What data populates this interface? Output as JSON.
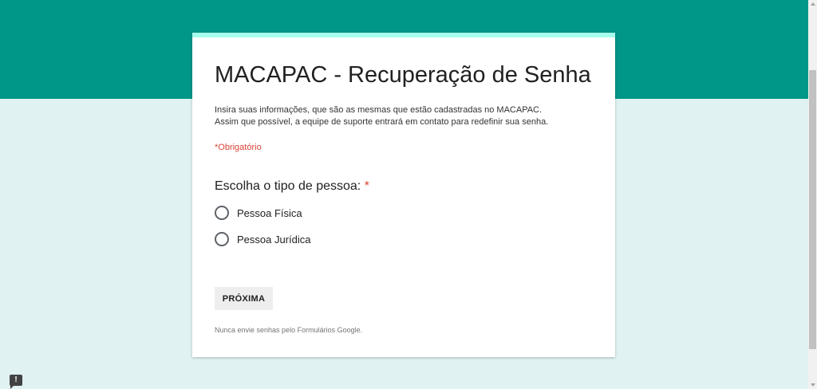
{
  "form": {
    "title": "MACAPAC - Recuperação de Senha",
    "description_line1": "Insira suas informações, que são as mesmas que estão cadastradas no MACAPAC.",
    "description_line2": "Assim que possível, a equipe de suporte entrará em contato para redefinir sua senha.",
    "required_note": "*Obrigatório",
    "question": {
      "label": "Escolha o tipo de pessoa:",
      "required_marker": "*",
      "options": [
        {
          "label": "Pessoa Física",
          "selected": false
        },
        {
          "label": "Pessoa Jurídica",
          "selected": false
        }
      ]
    },
    "next_button": "PRÓXIMA",
    "footer_note": "Nunca envie senhas pelo Formulários Google."
  },
  "feedback": {
    "icon": "report-problem-icon",
    "glyph": "!"
  },
  "colors": {
    "header_band": "#009688",
    "page_background": "#e0f2f1",
    "card_accent": "#a7ffeb",
    "required": "#db4437"
  }
}
